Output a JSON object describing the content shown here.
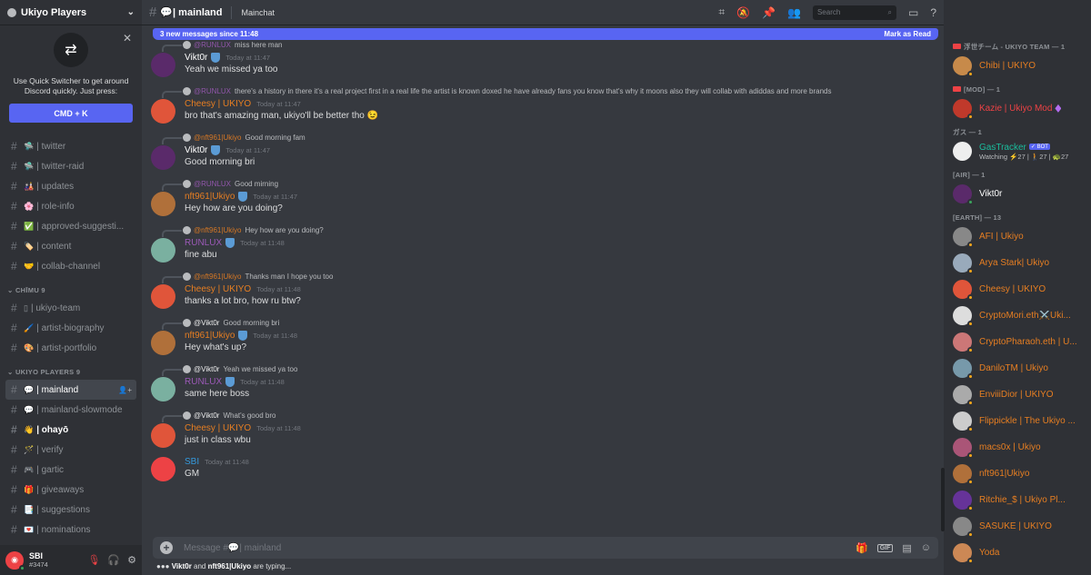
{
  "server": {
    "name": "Ukiyo Players"
  },
  "quick_switcher": {
    "text": "Use Quick Switcher to get around Discord quickly. Just press:",
    "button": "CMD + K"
  },
  "channels_top": [
    {
      "emoji": "🛸",
      "label": "| twitter"
    },
    {
      "emoji": "🛸",
      "label": "| twitter-raid"
    },
    {
      "emoji": "🎎",
      "label": "| updates"
    },
    {
      "emoji": "🌸",
      "label": "| role-info"
    },
    {
      "emoji": "✅",
      "label": "| approved-suggesti..."
    },
    {
      "emoji": "🏷️",
      "label": "| content"
    },
    {
      "emoji": "🤝",
      "label": "| collab-channel"
    }
  ],
  "category_1": "⌄ CHĪMU 9",
  "channels_team": [
    {
      "emoji": "▯",
      "label": "| ukiyo-team"
    },
    {
      "emoji": "🖌️",
      "label": "| artist-biography"
    },
    {
      "emoji": "🎨",
      "label": "| artist-portfolio"
    }
  ],
  "category_2": "⌄ UKIYO PLAYERS 9",
  "channels_players": [
    {
      "emoji": "💬",
      "label": "| mainland",
      "state": "active"
    },
    {
      "emoji": "💬",
      "label": "| mainland-slowmode",
      "state": ""
    },
    {
      "emoji": "👋",
      "label": "| ohayō",
      "state": "unread"
    },
    {
      "emoji": "🪄",
      "label": "| verify",
      "state": ""
    },
    {
      "emoji": "🎮",
      "label": "| gartic",
      "state": ""
    },
    {
      "emoji": "🎁",
      "label": "| giveaways",
      "state": ""
    },
    {
      "emoji": "📑",
      "label": "| suggestions",
      "state": ""
    },
    {
      "emoji": "💌",
      "label": "| nominations",
      "state": ""
    }
  ],
  "user": {
    "name": "SBI",
    "tag": "#3474"
  },
  "topbar": {
    "channel": "💬| mainland",
    "topic": "Mainchat",
    "search_placeholder": "Search"
  },
  "banner": {
    "text": "3 new messages since 11:48",
    "action": "Mark as Read"
  },
  "messages": [
    {
      "reply_name": "@RUNLUX",
      "reply_text": "miss here man",
      "author": "Vikt0r",
      "color": "white",
      "shield": true,
      "time": "Today at 11:47",
      "content": "Yeah we missed ya too",
      "av": "#5a2a6a"
    },
    {
      "reply_name": "@RUNLUX",
      "reply_text": "there's a history in there it's a real project first in a real life the artist is known doxed he have already fans you know that's why it moons also they will collab with adiddas and more brands",
      "author": "Cheesy | UKIYO",
      "color": "orange",
      "shield": false,
      "time": "Today at 11:47",
      "content": "bro that's amazing man, ukiyo'll be better tho 😉",
      "av": "#e0553a"
    },
    {
      "reply_name": "@nft961|Ukiyo",
      "reply_text": "Good morning fam",
      "author": "Vikt0r",
      "color": "white",
      "shield": true,
      "time": "Today at 11:47",
      "content": "Good morning bri",
      "av": "#5a2a6a"
    },
    {
      "reply_name": "@RUNLUX",
      "reply_text": "Good mirning",
      "author": "nft961|Ukiyo",
      "color": "orange",
      "shield": true,
      "time": "Today at 11:47",
      "content": "Hey how are you doing?",
      "av": "#b0703a"
    },
    {
      "reply_name": "@nft961|Ukiyo",
      "reply_text": "Hey how are you doing?",
      "author": "RUNLUX",
      "color": "purple",
      "shield": true,
      "time": "Today at 11:48",
      "content": "fine abu",
      "av": "#7ab0a0"
    },
    {
      "reply_name": "@nft961|Ukiyo",
      "reply_text": "Thanks man I hope you too",
      "author": "Cheesy | UKIYO",
      "color": "orange",
      "shield": false,
      "time": "Today at 11:48",
      "content": "thanks a lot bro, how ru btw?",
      "av": "#e0553a"
    },
    {
      "reply_name": "@Vikt0r",
      "reply_text": "Good morning bri",
      "author": "nft961|Ukiyo",
      "color": "orange",
      "shield": true,
      "time": "Today at 11:48",
      "content": "Hey what's up?",
      "av": "#b0703a"
    },
    {
      "reply_name": "@Vikt0r",
      "reply_text": "Yeah we missed ya too",
      "author": "RUNLUX",
      "color": "purple",
      "shield": true,
      "time": "Today at 11:48",
      "content": "same here boss",
      "av": "#7ab0a0"
    },
    {
      "reply_name": "@Vikt0r",
      "reply_text": "What's good bro",
      "author": "Cheesy | UKIYO",
      "color": "orange",
      "shield": false,
      "time": "Today at 11:48",
      "content": "just in class wbu",
      "av": "#e0553a"
    }
  ],
  "last_message": {
    "author": "SBI",
    "time": "Today at 11:48",
    "content": "GM"
  },
  "composer": {
    "placeholder": "Message #💬| mainland"
  },
  "typing": {
    "user1": "Vikt0r",
    "and": " and ",
    "user2": "nft961|Ukiyo",
    "suffix": " are typing..."
  },
  "members": {
    "team_label": "浮世チーム - UKIYO TEAM — 1",
    "team": [
      {
        "name": "Chibi | UKIYO",
        "av": "#c78a4a"
      }
    ],
    "mod_label": "[MOD] — 1",
    "mod": [
      {
        "name": "Kazie | Ukiyo Mod",
        "av": "#c0392b"
      }
    ],
    "gas_label": "ガス — 1",
    "gas": {
      "name": "GasTracker",
      "badge": "✓ BOT",
      "sub": "Watching ⚡27 | 🚶27 | 🐢27"
    },
    "air_label": "[AIR] — 1",
    "air": [
      {
        "name": "Vikt0r",
        "av": "#5a2a6a"
      }
    ],
    "earth_label": "[EARTH] — 13",
    "earth": [
      {
        "name": "AFI | Ukiyo",
        "av": "#888"
      },
      {
        "name": "Arya Stark| Ukiyo",
        "av": "#9ab"
      },
      {
        "name": "Cheesy | UKIYO",
        "av": "#e0553a"
      },
      {
        "name": "CryptoMori.eth⚔️Uki...",
        "av": "#ddd"
      },
      {
        "name": "CryptoPharaoh.eth | U...",
        "av": "#c77"
      },
      {
        "name": "DaniloTM | Ukiyo",
        "av": "#79a"
      },
      {
        "name": "EnviiiDior | UKIYO",
        "av": "#aaa"
      },
      {
        "name": "Flippickle | The Ukiyo ...",
        "av": "#ccc"
      },
      {
        "name": "macs0x | Ukiyo",
        "av": "#a57"
      },
      {
        "name": "nft961|Ukiyo",
        "av": "#b0703a"
      },
      {
        "name": "Ritchie_$ | Ukiyo Pl...",
        "av": "#639"
      },
      {
        "name": "SASUKE | UKIYO",
        "av": "#888"
      },
      {
        "name": "Yoda",
        "av": "#c85"
      }
    ]
  }
}
